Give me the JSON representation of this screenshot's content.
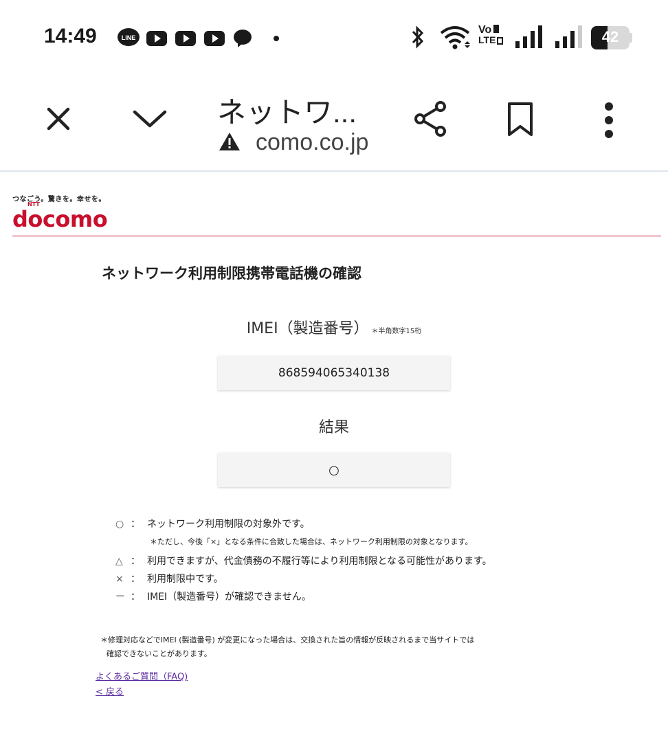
{
  "status_bar": {
    "time": "14:49",
    "battery": "42",
    "network_label_top": "Vo",
    "network_label_bottom": "LTE",
    "notification_icons": [
      "line-icon",
      "youtube-icon",
      "youtube-icon",
      "youtube-icon",
      "chat-bubble-icon",
      "dot-icon"
    ]
  },
  "browser": {
    "title": "ネットワ...",
    "url": "como.co.jp"
  },
  "site": {
    "tagline": "つなごう。驚きを。幸せを。",
    "logo_ntt": "NTT",
    "logo_text": "docomo",
    "brand_color": "#c8102e"
  },
  "main": {
    "page_title": "ネットワーク利用制限携帯電話機の確認",
    "imei_label": "IMEI（製造番号）",
    "imei_note": "＊半角数字15桁",
    "imei_value": "868594065340138",
    "result_label": "結果",
    "result_value": "○"
  },
  "legend": [
    {
      "symbol": "○",
      "colon": "：",
      "text": "ネットワーク利用制限の対象外です。"
    },
    {
      "symbol": "",
      "colon": "",
      "text": "＊ただし、今後「×」となる条件に合致した場合は、ネットワーク利用制限の対象となります。"
    },
    {
      "symbol": "△",
      "colon": "：",
      "text": "利用できますが、代金債務の不履行等により利用制限となる可能性があります。"
    },
    {
      "symbol": "×",
      "colon": "：",
      "text": "利用制限中です。"
    },
    {
      "symbol": "ー",
      "colon": "：",
      "text": "IMEI（製造番号）が確認できません。"
    }
  ],
  "footer": {
    "note_line1": "＊修理対応などでIMEI (製造番号) が変更になった場合は、交換された旨の情報が反映されるまで当サイトでは",
    "note_line2": "確認できないことがあります。",
    "faq_link": "よくあるご質問（FAQ)",
    "back_link": "< 戻る"
  }
}
